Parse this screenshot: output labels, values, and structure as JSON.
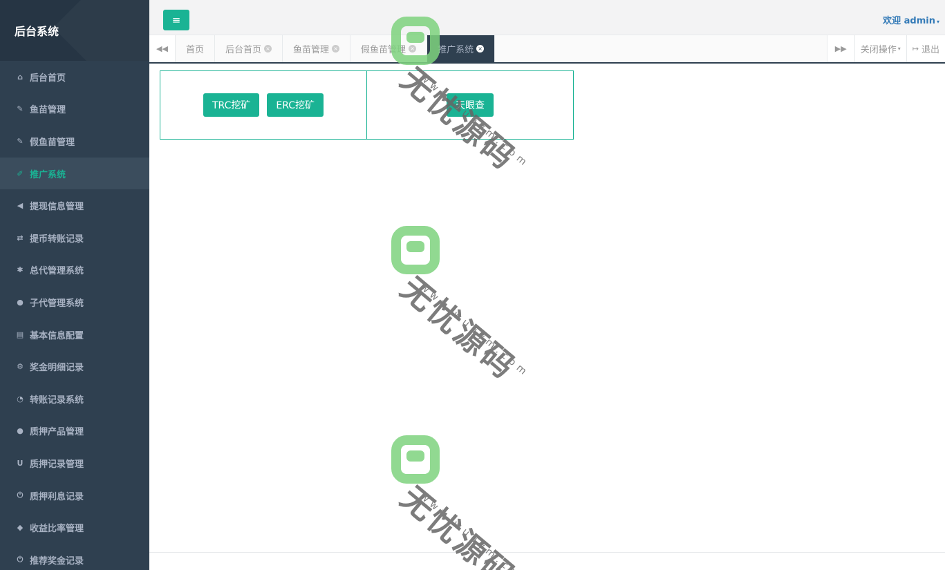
{
  "sidebar": {
    "title": "后台系统",
    "items": [
      {
        "label": "后台首页",
        "icon": "home-icon",
        "glyph": "⌂"
      },
      {
        "label": "鱼苗管理",
        "icon": "wrench-icon",
        "glyph": "✎"
      },
      {
        "label": "假鱼苗管理",
        "icon": "wrench-icon",
        "glyph": "✎"
      },
      {
        "label": "推广系统",
        "icon": "edit-icon",
        "glyph": "✐"
      },
      {
        "label": "提现信息管理",
        "icon": "bullhorn-icon",
        "glyph": "◀"
      },
      {
        "label": "提币转账记录",
        "icon": "random-icon",
        "glyph": "⇄"
      },
      {
        "label": "总代管理系统",
        "icon": "asterisk-icon",
        "glyph": "✱"
      },
      {
        "label": "子代管理系统",
        "icon": "users-icon",
        "glyph": "●"
      },
      {
        "label": "基本信息配置",
        "icon": "file-icon",
        "glyph": "▤"
      },
      {
        "label": "奖金明细记录",
        "icon": "cogs-icon",
        "glyph": "⚙"
      },
      {
        "label": "转账记录系统",
        "icon": "dashboard-icon",
        "glyph": "◔"
      },
      {
        "label": "质押产品管理",
        "icon": "comment-icon",
        "glyph": "●"
      },
      {
        "label": "质押记录管理",
        "icon": "magnet-icon",
        "glyph": "U"
      },
      {
        "label": "质押利息记录",
        "icon": "power-icon",
        "glyph": "⏻"
      },
      {
        "label": "收益比率管理",
        "icon": "shield-icon",
        "glyph": "◆"
      },
      {
        "label": "推荐奖金记录",
        "icon": "power-icon",
        "glyph": "⏻"
      }
    ]
  },
  "header": {
    "menu_glyph": "≡",
    "welcome": "欢迎 admin",
    "caret": "▾"
  },
  "tabs": {
    "left_arrow": "◀◀",
    "right_arrow": "▶▶",
    "items": [
      {
        "label": "首页",
        "closable": false
      },
      {
        "label": "后台首页",
        "closable": true
      },
      {
        "label": "鱼苗管理",
        "closable": true
      },
      {
        "label": "假鱼苗管理",
        "closable": true
      },
      {
        "label": "推广系统",
        "closable": true
      }
    ],
    "close_glyph": "×",
    "close_ops": "关闭操作",
    "logout": "退出",
    "logout_glyph": "↦"
  },
  "main": {
    "panel1_buttons": [
      "TRC挖矿",
      "ERC挖矿"
    ],
    "panel2_buttons": [
      "天眼查"
    ]
  },
  "watermark": {
    "text": "无忧源码",
    "url": "www.wuuym.com"
  },
  "colors": {
    "accent": "#1ab394",
    "sidebar_bg": "#2f4050",
    "sidebar_text": "#a7b1c2"
  }
}
